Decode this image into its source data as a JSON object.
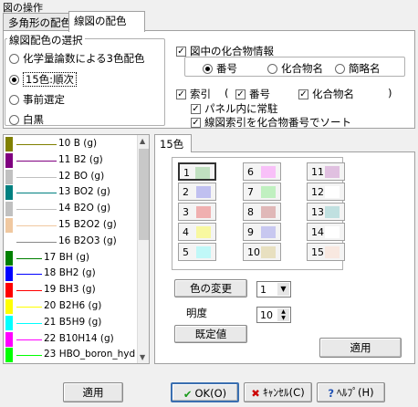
{
  "window": {
    "title": "図の操作"
  },
  "tabs": [
    {
      "label": "多角形の配色",
      "active": false
    },
    {
      "label": "線図の配色",
      "active": true
    }
  ],
  "scheme_group": {
    "title": "線図配色の選択",
    "options": [
      {
        "label": "化学量論数による3色配色",
        "selected": false
      },
      {
        "label": "15色:順次",
        "selected": true
      },
      {
        "label": "事前選定",
        "selected": false
      },
      {
        "label": "白黒",
        "selected": false
      }
    ]
  },
  "compound_info": {
    "label": "図中の化合物情報",
    "checked": true,
    "modes": [
      {
        "label": "番号",
        "selected": true
      },
      {
        "label": "化合物名",
        "selected": false
      },
      {
        "label": "簡略名",
        "selected": false
      }
    ]
  },
  "index": {
    "label": "索引",
    "checked": true,
    "open_paren": "(",
    "number": {
      "label": "番号",
      "checked": true
    },
    "compound_name": {
      "label": "化合物名",
      "checked": true
    },
    "close_paren": ")",
    "always_in_panel": {
      "label": "パネル内に常駐",
      "checked": true
    },
    "sort_by_number": {
      "label": "線図索引を化合物番号でソート",
      "checked": true
    }
  },
  "species_list": [
    {
      "label": "10 B (g)",
      "color": "#808000"
    },
    {
      "label": "11 B2 (g)",
      "color": "#800080"
    },
    {
      "label": "12 BO (g)",
      "color": "#c0c0c0"
    },
    {
      "label": "13 BO2 (g)",
      "color": "#008080"
    },
    {
      "label": "14 B2O (g)",
      "color": "#c0c0c0"
    },
    {
      "label": "15 B2O2 (g)",
      "color": "#f0c8a0"
    },
    {
      "label": "16 B2O3 (g)",
      "color": "#ffffff"
    },
    {
      "label": "17 BH (g)",
      "color": "#008000"
    },
    {
      "label": "18 BH2 (g)",
      "color": "#0000ff"
    },
    {
      "label": "19 BH3 (g)",
      "color": "#ff0000"
    },
    {
      "label": "20 B2H6 (g)",
      "color": "#ffff00"
    },
    {
      "label": "21 B5H9 (g)",
      "color": "#00ffff"
    },
    {
      "label": "22 B10H14 (g)",
      "color": "#ff00ff"
    },
    {
      "label": "23 HBO_boron_hyd",
      "color": "#00ff00"
    }
  ],
  "color_tab": {
    "label": "15色"
  },
  "color_buttons": [
    {
      "num": "1",
      "color": "#c0e0c0"
    },
    {
      "num": "2",
      "color": "#c0c0f0"
    },
    {
      "num": "3",
      "color": "#f0b0b0"
    },
    {
      "num": "4",
      "color": "#f8f8a0"
    },
    {
      "num": "5",
      "color": "#c0f8f8"
    },
    {
      "num": "6",
      "color": "#f8c0f8"
    },
    {
      "num": "7",
      "color": "#c0f0c0"
    },
    {
      "num": "8",
      "color": "#e0b8b8"
    },
    {
      "num": "9",
      "color": "#c8c8f0"
    },
    {
      "num": "10",
      "color": "#e8e0c0"
    },
    {
      "num": "11",
      "color": "#e0c0e0"
    },
    {
      "num": "12",
      "color": "#ffffff"
    },
    {
      "num": "13",
      "color": "#c0e0e0"
    },
    {
      "num": "14",
      "color": "#ffffff"
    },
    {
      "num": "15",
      "color": "#f8e8e0"
    }
  ],
  "controls": {
    "change_color": "色の変更",
    "color_select": "1",
    "brightness_label": "明度",
    "brightness_value": "10",
    "default_button": "既定値",
    "apply_inner": "適用"
  },
  "footer": {
    "apply": "適用",
    "ok": "OK(O)",
    "cancel": "ｷｬﾝｾﾙ(C)",
    "help": "ﾍﾙﾌﾟ(H)"
  }
}
